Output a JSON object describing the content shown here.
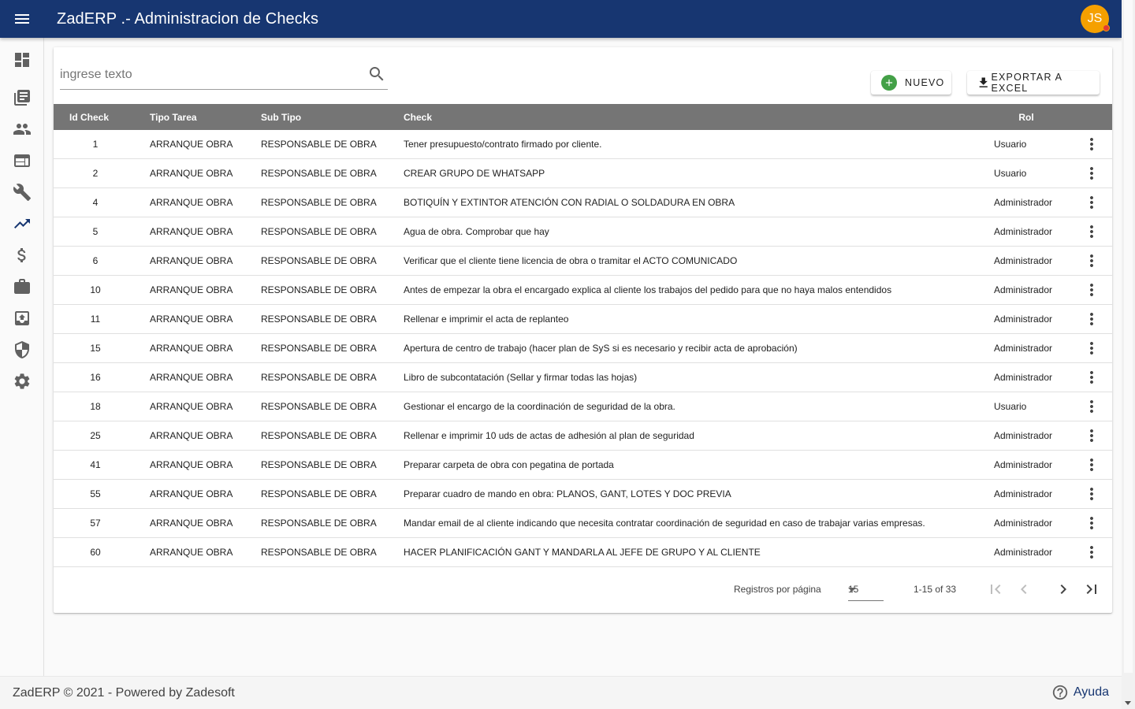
{
  "app": {
    "title": "ZadERP .- Administracion de Checks",
    "user_initials": "JS",
    "brand_color": "#173671",
    "avatar_color": "#f5a000"
  },
  "sidebar": {
    "items": [
      {
        "icon": "dashboard-icon"
      },
      {
        "icon": "library-books-icon"
      },
      {
        "icon": "people-icon"
      },
      {
        "icon": "web-window-icon"
      },
      {
        "icon": "wrench-icon"
      },
      {
        "icon": "trending-up-icon"
      },
      {
        "icon": "dollar-icon"
      },
      {
        "icon": "briefcase-icon"
      },
      {
        "icon": "archive-upload-icon"
      },
      {
        "icon": "shield-icon"
      },
      {
        "icon": "gear-icon"
      }
    ]
  },
  "search": {
    "placeholder": "ingrese texto",
    "value": ""
  },
  "toolbar": {
    "new_label": "NUEVO",
    "excel_label": "EXPORTAR A EXCEL"
  },
  "table": {
    "headers": {
      "id": "Id Check",
      "tipo": "Tipo Tarea",
      "sub": "Sub Tipo",
      "check": "Check",
      "rol": "Rol"
    },
    "rows": [
      {
        "id": "1",
        "tipo": "ARRANQUE OBRA",
        "sub": "RESPONSABLE DE OBRA",
        "check": "Tener presupuesto/contrato firmado por cliente.",
        "rol": "Usuario"
      },
      {
        "id": "2",
        "tipo": "ARRANQUE OBRA",
        "sub": "RESPONSABLE DE OBRA",
        "check": "CREAR GRUPO DE WHATSAPP",
        "rol": "Usuario"
      },
      {
        "id": "4",
        "tipo": "ARRANQUE OBRA",
        "sub": "RESPONSABLE DE OBRA",
        "check": "BOTIQUÍN Y EXTINTOR ATENCIÓN CON RADIAL O SOLDADURA EN OBRA",
        "rol": "Administrador"
      },
      {
        "id": "5",
        "tipo": "ARRANQUE OBRA",
        "sub": "RESPONSABLE DE OBRA",
        "check": "Agua de obra. Comprobar que hay",
        "rol": "Administrador"
      },
      {
        "id": "6",
        "tipo": "ARRANQUE OBRA",
        "sub": "RESPONSABLE DE OBRA",
        "check": "Verificar que el cliente tiene licencia de obra o tramitar el ACTO COMUNICADO",
        "rol": "Administrador"
      },
      {
        "id": "10",
        "tipo": "ARRANQUE OBRA",
        "sub": "RESPONSABLE DE OBRA",
        "check": "Antes de empezar la obra el encargado explica al cliente los trabajos del pedido para que no haya malos entendidos",
        "rol": "Administrador"
      },
      {
        "id": "11",
        "tipo": "ARRANQUE OBRA",
        "sub": "RESPONSABLE DE OBRA",
        "check": "Rellenar e imprimir el acta de replanteo",
        "rol": "Administrador"
      },
      {
        "id": "15",
        "tipo": "ARRANQUE OBRA",
        "sub": "RESPONSABLE DE OBRA",
        "check": "Apertura de centro de trabajo (hacer plan de SyS si es necesario y recibir acta de aprobación)",
        "rol": "Administrador"
      },
      {
        "id": "16",
        "tipo": "ARRANQUE OBRA",
        "sub": "RESPONSABLE DE OBRA",
        "check": "Libro de subcontatación (Sellar y firmar todas las hojas)",
        "rol": "Administrador"
      },
      {
        "id": "18",
        "tipo": "ARRANQUE OBRA",
        "sub": "RESPONSABLE DE OBRA",
        "check": "Gestionar el encargo de la coordinación de seguridad de la obra.",
        "rol": "Usuario"
      },
      {
        "id": "25",
        "tipo": "ARRANQUE OBRA",
        "sub": "RESPONSABLE DE OBRA",
        "check": "Rellenar e imprimir 10 uds de actas de adhesión al plan de seguridad",
        "rol": "Administrador"
      },
      {
        "id": "41",
        "tipo": "ARRANQUE OBRA",
        "sub": "RESPONSABLE DE OBRA",
        "check": "Preparar carpeta de obra con pegatina de portada",
        "rol": "Administrador"
      },
      {
        "id": "55",
        "tipo": "ARRANQUE OBRA",
        "sub": "RESPONSABLE DE OBRA",
        "check": "Preparar cuadro de mando en obra: PLANOS, GANT, LOTES Y DOC PREVIA",
        "rol": "Administrador"
      },
      {
        "id": "57",
        "tipo": "ARRANQUE OBRA",
        "sub": "RESPONSABLE DE OBRA",
        "check": "Mandar email de al cliente indicando que necesita contratar coordinación de seguridad en caso de trabajar varias empresas.",
        "rol": "Administrador"
      },
      {
        "id": "60",
        "tipo": "ARRANQUE OBRA",
        "sub": "RESPONSABLE DE OBRA",
        "check": "HACER PLANIFICACIÓN GANT Y MANDARLA AL JEFE DE GRUPO Y AL CLIENTE",
        "rol": "Administrador"
      }
    ]
  },
  "paginator": {
    "label": "Registros por página",
    "page_size": "15",
    "range": "1-15 of 33"
  },
  "footer": {
    "text": "ZadERP © 2021 - Powered by Zadesoft",
    "help_label": "Ayuda"
  }
}
